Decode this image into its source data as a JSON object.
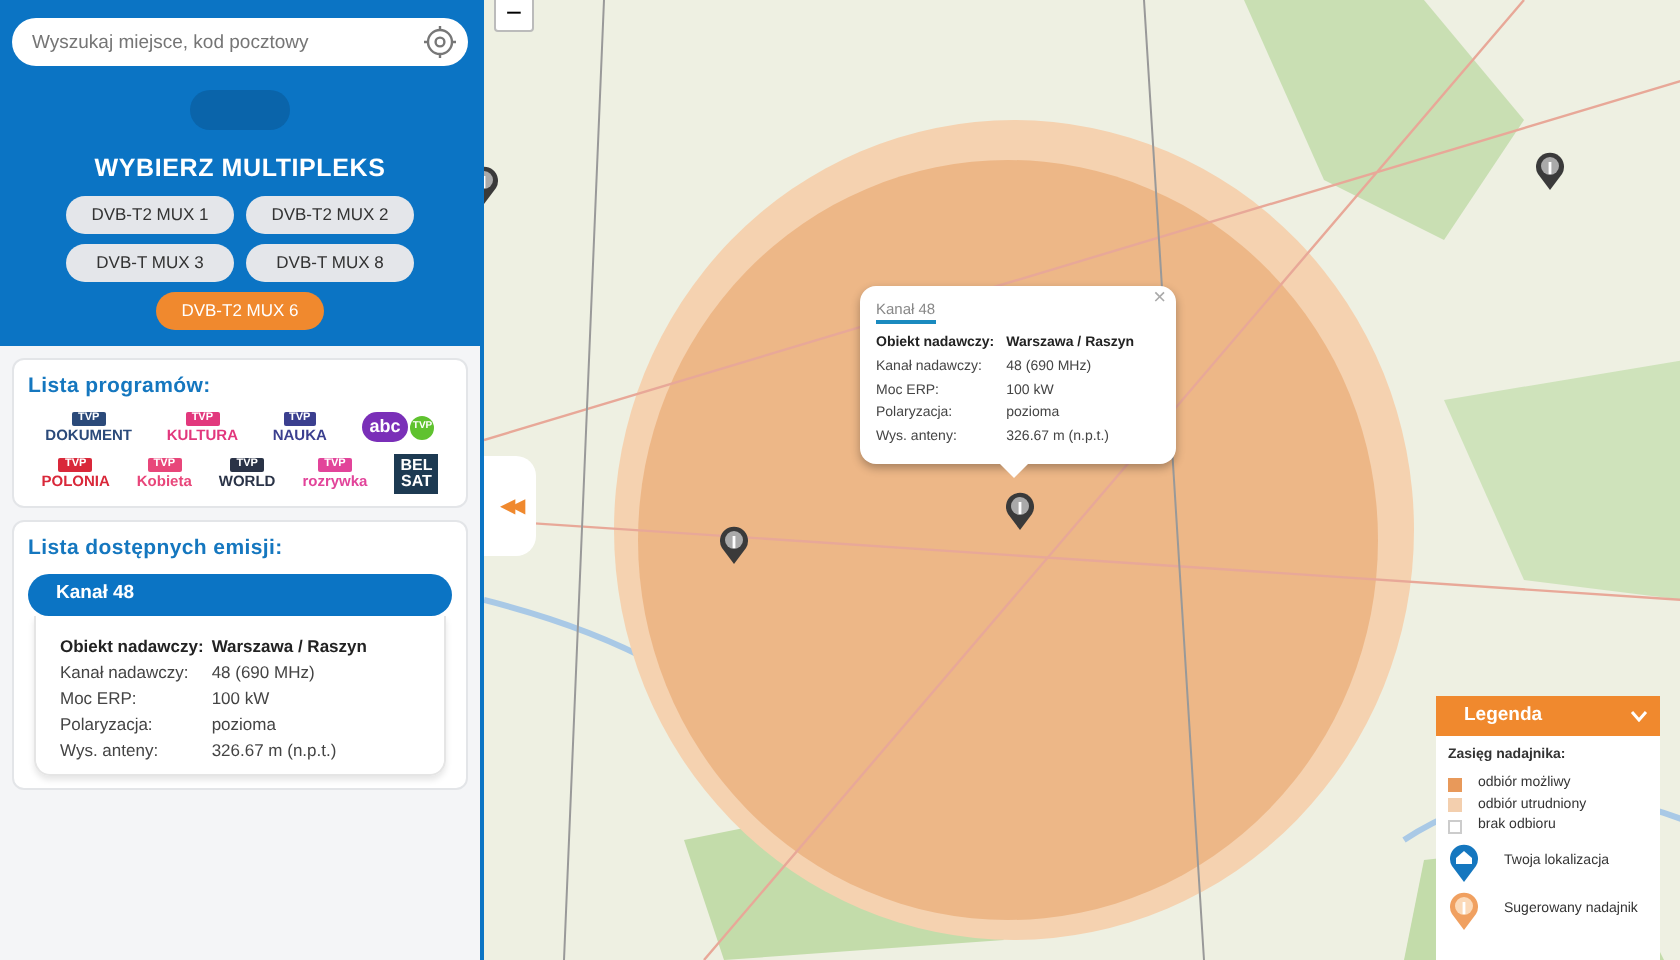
{
  "search": {
    "placeholder": "Wyszukaj miejsce, kod pocztowy"
  },
  "search_button": {
    "disabled": true
  },
  "multiplex": {
    "title": "WYBIERZ MULTIPLEKS",
    "options": [
      {
        "label": "DVB-T2 MUX 1",
        "selected": false
      },
      {
        "label": "DVB-T2 MUX 2",
        "selected": false
      },
      {
        "label": "DVB-T MUX 3",
        "selected": false
      },
      {
        "label": "DVB-T MUX 8",
        "selected": false
      },
      {
        "label": "DVB-T2 MUX 6",
        "selected": true
      }
    ]
  },
  "programs": {
    "title": "Lista programów:",
    "channels": [
      {
        "kind": "tvp",
        "badge": "TVP",
        "name": "DOKUMENT",
        "color": "#2b4a7a"
      },
      {
        "kind": "tvp",
        "badge": "TVP",
        "name": "KULTURA",
        "color": "#e2387d"
      },
      {
        "kind": "tvp",
        "badge": "TVP",
        "name": "NAUKA",
        "color": "#3b3f8f"
      },
      {
        "kind": "bubble",
        "badge": "TVP",
        "name": "abc",
        "color": "#7a2fb8"
      },
      {
        "kind": "tvp",
        "badge": "TVP",
        "name": "POLONIA",
        "color": "#d9283a"
      },
      {
        "kind": "tvp",
        "badge": "TVP",
        "name": "Kobieta",
        "color": "#e8467a"
      },
      {
        "kind": "tvp",
        "badge": "TVP",
        "name": "WORLD",
        "color": "#2a3347"
      },
      {
        "kind": "tvp",
        "badge": "TVP",
        "name": "rozrywka",
        "color": "#e2449a"
      },
      {
        "kind": "block",
        "badge": "BEL",
        "name": "SAT",
        "color": "#1d3a52"
      }
    ]
  },
  "emissions": {
    "title": "Lista dostępnych emisji:",
    "items": [
      {
        "channel": "Kanał 48",
        "station_label": "Obiekt nadawczy:",
        "station": "Warszawa / Raszyn",
        "rows": [
          {
            "label": "Kanał nadawczy:",
            "value": "48 (690 MHz)"
          },
          {
            "label": "Moc ERP:",
            "value": "100 kW"
          },
          {
            "label": "Polaryzacja:",
            "value": "pozioma"
          },
          {
            "label": "Wys. anteny:",
            "value": "326.67 m (n.p.t.)"
          }
        ]
      }
    ]
  },
  "map": {
    "zoom_out": "−",
    "collapse": "◀◀",
    "popup": {
      "tab": "Kanał 48",
      "close": "×",
      "station_label": "Obiekt nadawczy:",
      "station": "Warszawa / Raszyn",
      "rows": [
        {
          "label": "Kanał nadawczy:",
          "value": "48 (690 MHz)"
        },
        {
          "label": "Moc ERP:",
          "value": "100 kW"
        },
        {
          "label": "Polaryzacja:",
          "value": "pozioma"
        },
        {
          "label": "Wys. anteny:",
          "value": "326.67 m (n.p.t.)"
        }
      ]
    }
  },
  "legend": {
    "title": "Legenda",
    "expanded": true,
    "subtitle": "Zasięg nadajnika:",
    "ranges": [
      {
        "label": "odbiór możliwy",
        "color": "#e8995a"
      },
      {
        "label": "odbiór utrudniony",
        "color": "#f3cfae"
      },
      {
        "label": "brak odbioru",
        "color": "#ffffff"
      }
    ],
    "markers": [
      {
        "kind": "home",
        "label": "Twoja lokalizacja"
      },
      {
        "kind": "tower",
        "label": "Sugerowany nadajnik"
      }
    ]
  }
}
